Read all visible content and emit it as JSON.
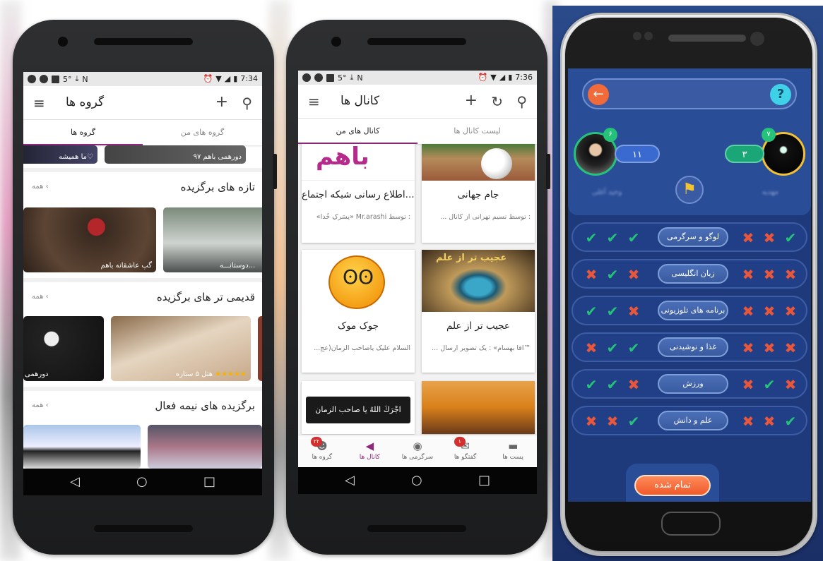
{
  "phone1": {
    "status": {
      "time": "7:34",
      "temp": "5°"
    },
    "title": "گروه ها",
    "tabs": [
      "گروه ها",
      "گروه های من"
    ],
    "top_row": {
      "left_caption": "ما همیشه♡",
      "right_caption": "دورهمی باهم ۹۷"
    },
    "sections": [
      {
        "title": "تازه های برگزیده",
        "more": "همه",
        "cards": [
          "گپ عاشقانه باهم",
          "دوستانـــه..."
        ]
      },
      {
        "title": "قدیمی تر های برگزیده",
        "more": "همه",
        "cards": [
          "دورهمی",
          "هتل ۵ ستاره"
        ],
        "stars": "★★★★★"
      },
      {
        "title": "برگزیده های نیمه فعال",
        "more": "همه"
      }
    ]
  },
  "phone2": {
    "status": {
      "time": "7:36",
      "temp": "5°"
    },
    "title": "کانال ها",
    "tabs": [
      "کانال های من",
      "لیست کانال ها"
    ],
    "cards": [
      {
        "title": "جام جهانی",
        "desc": ": توسط نسیم تهرانی از کانال ..."
      },
      {
        "title": "اطلاع رسانی شبکه اجتماع...",
        "desc": ": توسط Mr.arashi «پسَرکِ خُدا»"
      },
      {
        "title": "عجیب تر از علم",
        "desc": "™آقا بهسام» : یک تصویر ارسال ..."
      },
      {
        "title": "جوک موک",
        "desc": "السلام علیک یاصاحب الزمان(عج..."
      }
    ],
    "img_texts": {
      "bahom": "باهم",
      "ajib": "عجیب تر از علم",
      "banner": "اجْرَكَ اللهُ يا صاحب الزمان"
    },
    "bottom_nav": [
      {
        "label": "پست ها",
        "icon": "▬"
      },
      {
        "label": "گفتگو ها",
        "icon": "✉",
        "badge": "۱"
      },
      {
        "label": "سرگرمی ها",
        "icon": "◉"
      },
      {
        "label": "کانال ها",
        "icon": "◀"
      },
      {
        "label": "گروه ها",
        "icon": "☻",
        "badge": "۲۲"
      }
    ]
  },
  "phone3": {
    "player_left": {
      "level": "۶",
      "score": "۱۱",
      "name": "وحید آغلی"
    },
    "player_right": {
      "level": "۷",
      "score": "۳",
      "name": "مهدیه"
    },
    "help": "?",
    "categories": [
      {
        "name": "لوگو و سرگرمی",
        "left": [
          "ok",
          "ok",
          "ok"
        ],
        "right": [
          "no",
          "no",
          "ok"
        ]
      },
      {
        "name": "زبان انگلیسی",
        "left": [
          "no",
          "ok",
          "no"
        ],
        "right": [
          "no",
          "no",
          "no"
        ]
      },
      {
        "name": "برنامه های تلوزیونی",
        "left": [
          "ok",
          "ok",
          "no"
        ],
        "right": [
          "no",
          "no",
          "no"
        ]
      },
      {
        "name": "غذا و نوشیدنی",
        "left": [
          "no",
          "ok",
          "ok"
        ],
        "right": [
          "no",
          "no",
          "no"
        ]
      },
      {
        "name": "ورزش",
        "left": [
          "ok",
          "ok",
          "no"
        ],
        "right": [
          "no",
          "ok",
          "no"
        ]
      },
      {
        "name": "علم و دانش",
        "left": [
          "no",
          "no",
          "ok"
        ],
        "right": [
          "no",
          "no",
          "ok"
        ]
      }
    ],
    "finish": "تمام شده"
  },
  "colors": {
    "accent": "#8e2a7b",
    "quiz_bg": "#1e3a7a",
    "ok": "#25c27a",
    "no": "#e8563c",
    "finish": "#f06a3a"
  }
}
